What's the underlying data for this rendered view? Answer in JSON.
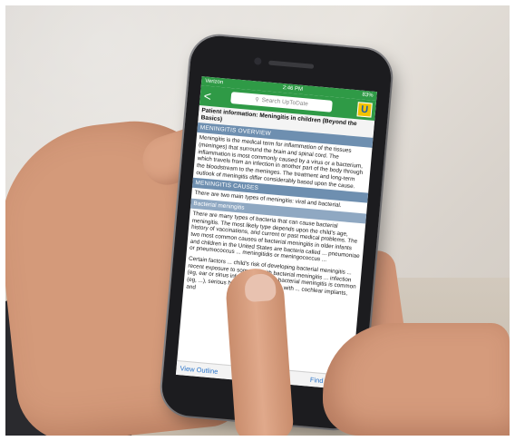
{
  "status_bar": {
    "carrier": "Verizon",
    "time": "2:46 PM",
    "battery": "83%"
  },
  "nav": {
    "back_glyph": "<",
    "search_placeholder": "Search UpToDate",
    "logo_letter": "U",
    "logo_icon": "uptodate-logo-icon"
  },
  "article": {
    "title": "Patient information: Meningitis in children (Beyond the Basics)",
    "sections": [
      {
        "header": "MENINGITIS OVERVIEW",
        "text": "Meningitis is the medical term for inflammation of the tissues (meninges) that surround the brain and spinal cord. The inflammation is most commonly caused by a virus or a bacterium, which travels from an infection in another part of the body through the bloodstream to the meninges. The treatment and long-term outlook of meningitis differ considerably based upon the cause."
      },
      {
        "header": "MENINGITIS CAUSES",
        "text": "There are two main types of meningitis: viral and bacterial."
      }
    ],
    "subsection": {
      "header": "Bacterial meningitis",
      "text1": "There are many types of bacteria that can cause bacterial meningitis. The most likely type depends upon the child's age, history of vaccinations, and current or past medical problems. The two most common causes of bacterial meningitis in older infants and children in the United States are bacteria called ... pneumoniae or pneumococcus ... meningitidis or meningococcus ...",
      "text2": "Certain factors ... child's risk of developing bacterial meningitis ... recent exposure to someone with bacterial meningitis ... infection (eg, ear or sinus infection), travel ... bacterial meningitis is common (eg, ...), serious head injury, problems with ... cochlear implants, and"
    }
  },
  "bottom_bar": {
    "left_label": "View Outline",
    "right_label": "Find in Topic"
  },
  "colors": {
    "app_green": "#2f9a46",
    "section_blue": "#6e8fb0",
    "link_blue": "#2a74c9"
  }
}
